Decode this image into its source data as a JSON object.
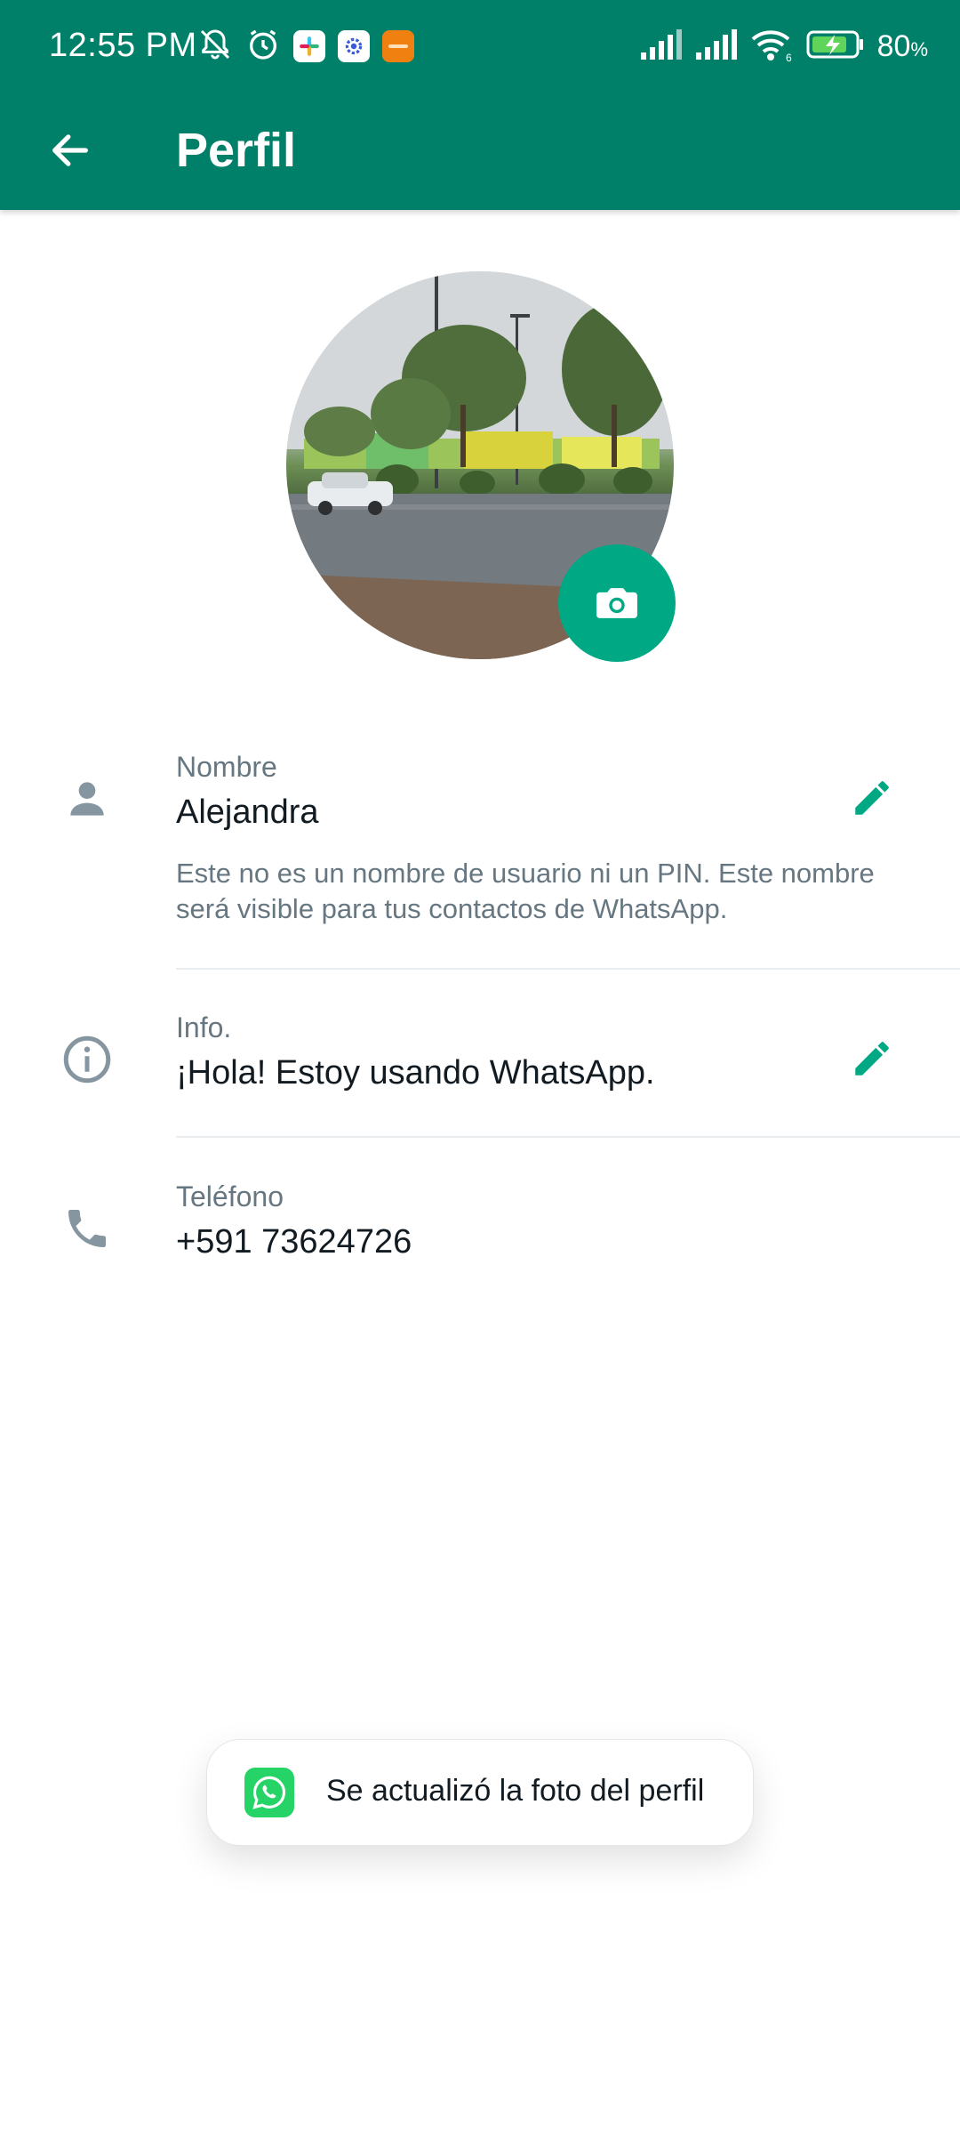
{
  "status_bar": {
    "time": "12:55 PM",
    "battery_percent": "80",
    "battery_unit": "%",
    "left_icons": [
      "notifications-muted-icon",
      "alarm-icon",
      "slack-icon",
      "settings-app-icon",
      "orange-app-icon"
    ],
    "right_icons": [
      "signal-1-icon",
      "signal-2-icon",
      "wifi-6-icon",
      "battery-charging-icon"
    ]
  },
  "app_bar": {
    "title": "Perfil",
    "back_icon": "arrow-back-icon"
  },
  "profile": {
    "camera_icon": "camera-icon"
  },
  "name_row": {
    "label": "Nombre",
    "value": "Alejandra",
    "hint": "Este no es un nombre de usuario ni un PIN. Este nombre será visible para tus contactos de WhatsApp.",
    "icon": "person-icon",
    "edit_icon": "pencil-icon"
  },
  "about_row": {
    "label": "Info.",
    "value": "¡Hola! Estoy usando WhatsApp.",
    "icon": "info-icon",
    "edit_icon": "pencil-icon"
  },
  "phone_row": {
    "label": "Teléfono",
    "value": "+591 73624726",
    "icon": "phone-icon"
  },
  "toast": {
    "message": "Se actualizó la foto del perfil",
    "icon": "whatsapp-icon"
  },
  "colors": {
    "brand_dark": "#008069",
    "accent": "#00a884",
    "secondary_text": "#667781",
    "icon_gray": "#8696a0"
  }
}
